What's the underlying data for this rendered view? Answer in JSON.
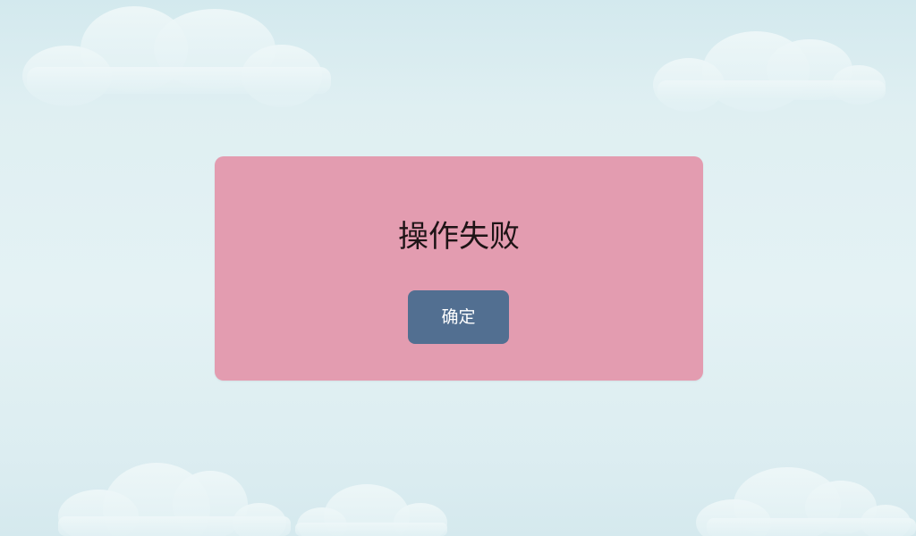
{
  "dialog": {
    "message": "操作失败",
    "confirm_label": "确定"
  },
  "colors": {
    "dialog_background": "#e39cb0",
    "button_background": "#526f91",
    "button_text": "#ffffff",
    "sky_background": "#dfeff2"
  }
}
